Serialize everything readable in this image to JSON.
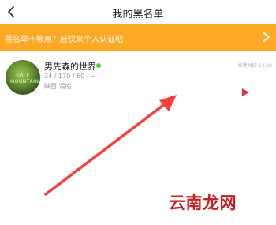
{
  "nav": {
    "title": "我的黑名单",
    "back_icon": "chevron-left-icon"
  },
  "banner": {
    "text": "黑名单不够用？赶快来个人认证吧！",
    "arrow_icon": "chevron-right-icon",
    "color": "#ffa826"
  },
  "card": {
    "name": "男先森的世界",
    "meta": "34 / 170 / 60 - ~",
    "location": "陕西 渭南",
    "time": "拉黑时间 14:00",
    "avatar_text": "SOLE MOUNTAIN",
    "online_color": "#4cd137",
    "play_icon": "play-triangle-icon",
    "play_color": "#e8302a"
  },
  "watermark": {
    "text": "云南龙网",
    "color": "#c81e1e"
  }
}
